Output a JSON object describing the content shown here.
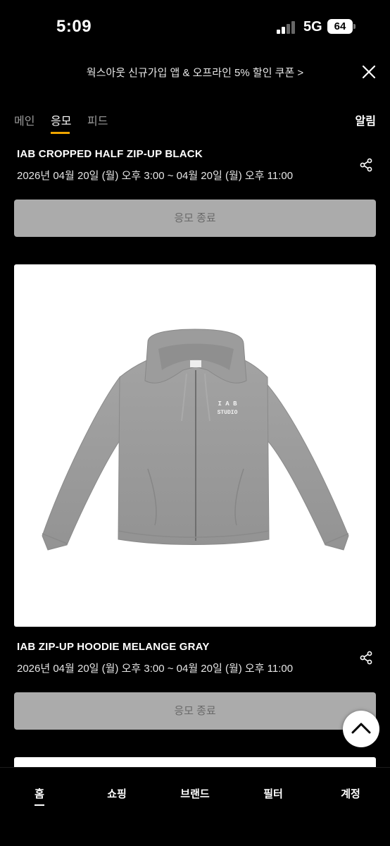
{
  "status": {
    "time": "5:09",
    "network": "5G",
    "battery": "64"
  },
  "promo": {
    "text": "웍스아웃 신규가입 앱 & 오프라인 5% 할인 쿠폰 >"
  },
  "tabs": [
    {
      "label": "메인",
      "active": false
    },
    {
      "label": "응모",
      "active": true
    },
    {
      "label": "피드",
      "active": false
    }
  ],
  "alarm_label": "알림",
  "items": [
    {
      "title": "IAB CROPPED HALF ZIP-UP BLACK",
      "date": "2026년 04월 20일 (월) 오후 3:00 ~ 04월 20일 (월) 오후 11:00",
      "button": "응모 종료"
    },
    {
      "title": "IAB ZIP-UP HOODIE MELANGE GRAY",
      "date": "2026년 04월 20일 (월) 오후 3:00 ~ 04월 20일 (월) 오후 11:00",
      "button": "응모 종료",
      "image_print": [
        "I A B",
        "STUDIO"
      ]
    }
  ],
  "bottom_nav": [
    {
      "label": "홈",
      "active": true
    },
    {
      "label": "쇼핑",
      "active": false
    },
    {
      "label": "브랜드",
      "active": false
    },
    {
      "label": "필터",
      "active": false
    },
    {
      "label": "계정",
      "active": false
    }
  ],
  "colors": {
    "background": "#000000",
    "accent": "#f0a500",
    "button_disabled": "#ababab",
    "hoodie": "#9a9a9a"
  },
  "icons": [
    "signal-icon",
    "battery-icon",
    "close-icon",
    "share-icon",
    "chevron-up-icon"
  ]
}
